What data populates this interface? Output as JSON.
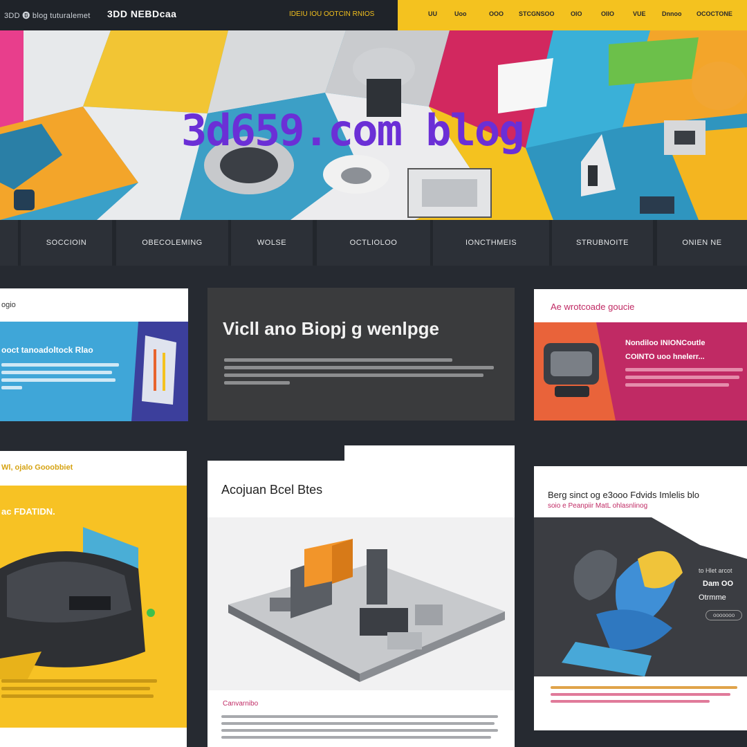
{
  "topbar": {
    "brand_small": "3DD 🅑 blog tuturalemet",
    "brand": "3DD NEBDcaa",
    "tagline": "IDEIU IOU OOTCIN RNIOS",
    "nav_items": [
      "UU",
      "Uoo",
      "OOO",
      "STCGNSOO",
      "OIO",
      "OIIO",
      "VUE",
      "Dnnoo",
      "OCOCTONE"
    ]
  },
  "hero": {
    "title": "3d659.com blog"
  },
  "subnav": {
    "items": [
      "",
      "SOCCIOIN",
      "OBECOLEMING",
      "WOLSE",
      "OCTLIOLOO",
      "IONCTHMEIS",
      "STRUBNOITE",
      "ONIEN NE"
    ]
  },
  "cards": {
    "card1": {
      "label": "ogio",
      "title": "ooct tanoadoltock Rlao",
      "lines": 4
    },
    "card2": {
      "title": "Vicll ano Biopj g wenlpge",
      "lines": 4
    },
    "card3": {
      "label": "Ae wrotcoade goucie",
      "title1": "Nondiloo INIONCoutle",
      "title2": "COINTO uoo hnelerr...",
      "lines": 3
    },
    "card4": {
      "label": "Wl, ojalo Gooobbiet",
      "title": "ac FDATIDN."
    },
    "card5": {
      "title": "Acojuan Bcel Btes",
      "subtitle": "Canvarnibo"
    },
    "card6": {
      "title1": "Berg sinct og e3ooo Fdvids Imlelis blo",
      "title2": "soio e Peanpiir MatL ohlasnlinog",
      "side1": "to Hlet arcot",
      "side2": "Dam OO",
      "side3": "Otrmme",
      "button": "ooooooo"
    }
  },
  "colors": {
    "background": "#262a31",
    "yellow": "#f4c21f",
    "magenta": "#c22266",
    "blue": "#3fa6cf",
    "title_purple": "#6b2fd6"
  }
}
